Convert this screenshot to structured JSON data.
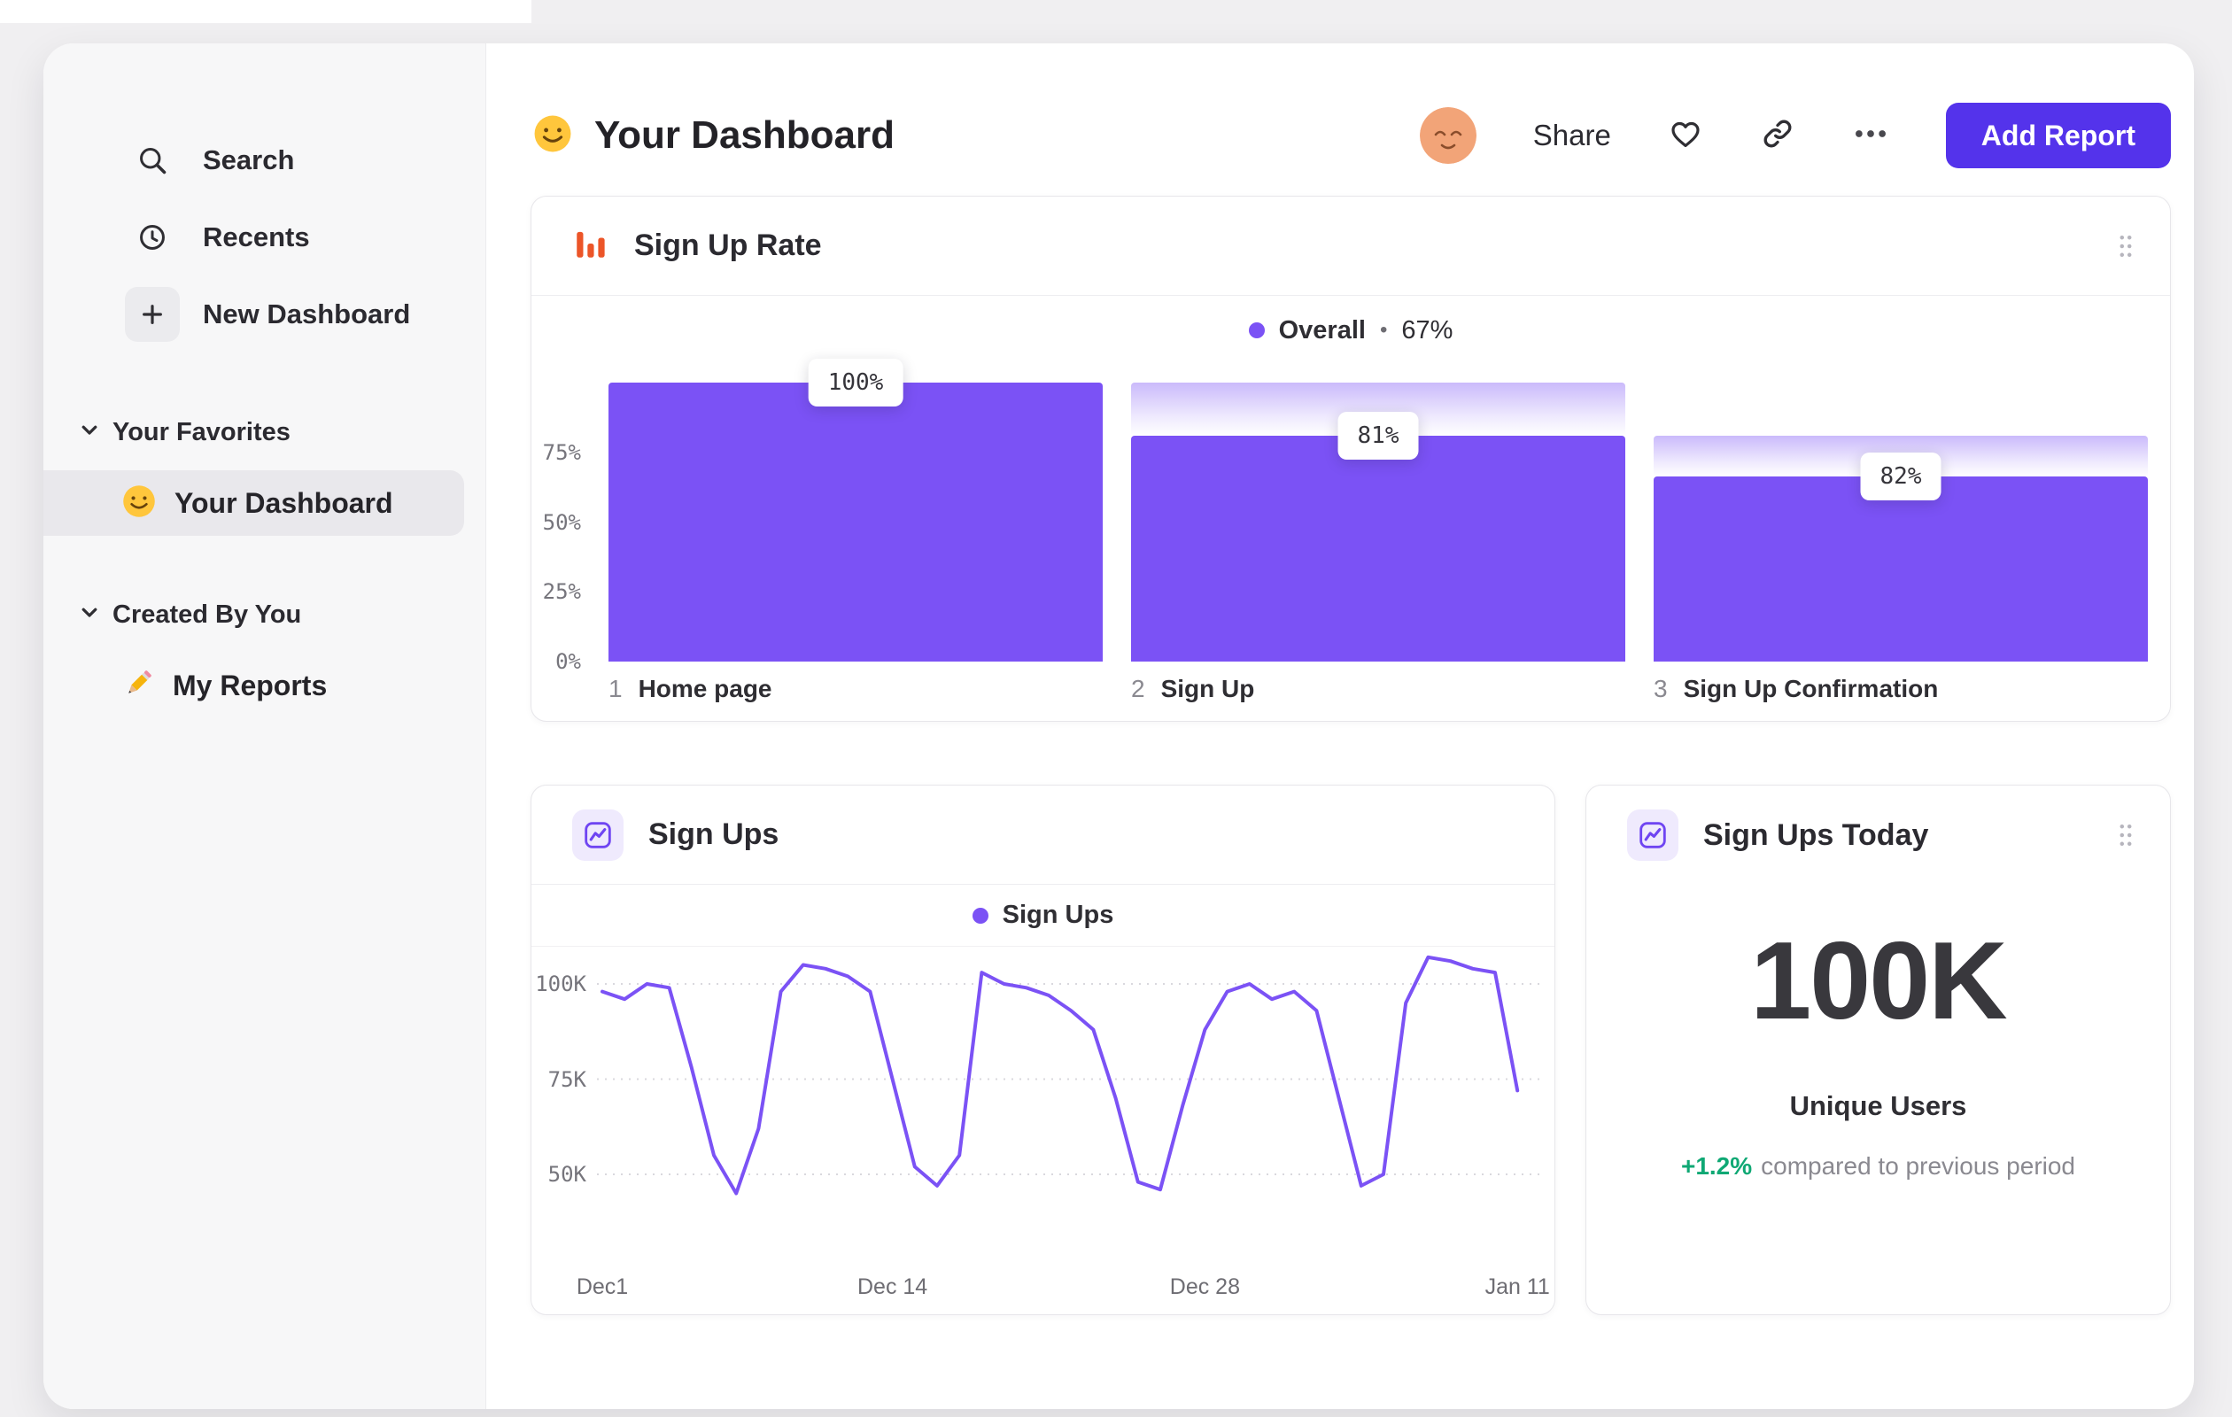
{
  "colors": {
    "accent": "#7B52F5",
    "button": "#5433EB",
    "positive": "#0FA874",
    "funnel_icon": "#EC5528"
  },
  "sidebar": {
    "search": "Search",
    "recents": "Recents",
    "new_dashboard": "New Dashboard",
    "favorites_title": "Your Favorites",
    "favorites_item": "Your Dashboard",
    "created_title": "Created By You",
    "created_item": "My Reports"
  },
  "header": {
    "title": "Your Dashboard",
    "share": "Share",
    "add_report": "Add Report"
  },
  "funnel_card": {
    "title": "Sign Up Rate",
    "legend_label": "Overall",
    "legend_sep": "•",
    "legend_value": "67%"
  },
  "signups_card": {
    "title": "Sign Ups",
    "legend_label": "Sign Ups"
  },
  "metric_card": {
    "title": "Sign Ups Today",
    "value": "100K",
    "caption": "Unique Users",
    "delta": "+1.2%",
    "delta_note": "compared to previous period"
  },
  "chart_data": [
    {
      "type": "bar",
      "subtype": "funnel",
      "title": "Sign Up Rate",
      "series_name": "Overall",
      "overall_conversion": "67%",
      "categories": [
        "Home page",
        "Sign Up",
        "Sign Up Confirmation"
      ],
      "step_numbers": [
        "1",
        "2",
        "3"
      ],
      "step_conversion_labels": [
        "100%",
        "81%",
        "82%"
      ],
      "values_pct_of_first": [
        100,
        81,
        66.5
      ],
      "prev_step_pct_of_first": [
        100,
        100,
        81
      ],
      "ylim": [
        0,
        100
      ],
      "y_ticks": [
        {
          "label": "75%",
          "value": 75
        },
        {
          "label": "50%",
          "value": 50
        },
        {
          "label": "25%",
          "value": 25
        },
        {
          "label": "0%",
          "value": 0
        }
      ],
      "legend_position": "top-center",
      "grid": "off"
    },
    {
      "type": "line",
      "title": "Sign Ups",
      "unit": "K",
      "series": [
        {
          "name": "Sign Ups",
          "values": [
            98,
            96,
            100,
            99,
            78,
            55,
            45,
            62,
            98,
            105,
            104,
            102,
            98,
            75,
            52,
            47,
            55,
            103,
            100,
            99,
            97,
            93,
            88,
            70,
            48,
            46,
            68,
            88,
            98,
            100,
            96,
            98,
            93,
            70,
            47,
            50,
            95,
            107,
            106,
            104,
            103,
            72
          ]
        }
      ],
      "x_ticks": [
        {
          "label": "Dec1",
          "day": 0
        },
        {
          "label": "Dec 14",
          "day": 13
        },
        {
          "label": "Dec 28",
          "day": 27
        },
        {
          "label": "Jan 11",
          "day": 41
        }
      ],
      "y_ticks": [
        {
          "label": "100K",
          "value": 100
        },
        {
          "label": "75K",
          "value": 75
        },
        {
          "label": "50K",
          "value": 50
        }
      ],
      "ylim": [
        30,
        110
      ],
      "grid": "dotted-horizontal",
      "legend_position": "top-center"
    }
  ]
}
